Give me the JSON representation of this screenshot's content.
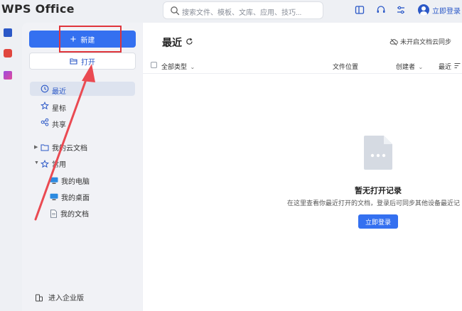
{
  "app": {
    "logo": "WPS Office"
  },
  "search": {
    "placeholder": "搜索文件、模板、文库、应用、技巧..."
  },
  "topbar": {
    "login_label": "立即登录"
  },
  "sidebar": {
    "new_label": "新建",
    "open_label": "打开",
    "nav": [
      {
        "label": "最近",
        "icon": "clock-icon"
      },
      {
        "label": "星标",
        "icon": "star-icon"
      },
      {
        "label": "共享",
        "icon": "share-icon"
      }
    ],
    "tree": {
      "cloud_label": "我的云文档",
      "common_label": "常用",
      "items": [
        {
          "label": "我的电脑",
          "icon": "computer-icon"
        },
        {
          "label": "我的桌面",
          "icon": "desktop-icon"
        },
        {
          "label": "我的文档",
          "icon": "document-icon"
        }
      ]
    },
    "enterprise_label": "进入企业版"
  },
  "main": {
    "title": "最近",
    "sync_label": "未开启文档云同步",
    "columns": {
      "all_types": "全部类型",
      "location": "文件位置",
      "creator": "创建者",
      "recent": "最近"
    },
    "empty": {
      "title": "暂无打开记录",
      "subtitle": "在这里查看你最近打开的文档，登录后可同步其他设备最近记",
      "login_button": "立即登录"
    }
  },
  "colors": {
    "accent": "#3470f0",
    "highlight_annotation": "#e0353b",
    "annotation_arrow": "#ea4a52"
  }
}
